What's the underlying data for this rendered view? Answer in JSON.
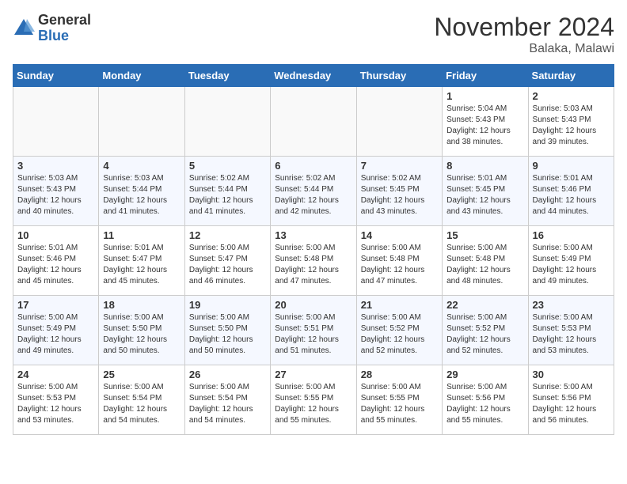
{
  "logo": {
    "general": "General",
    "blue": "Blue"
  },
  "title": "November 2024",
  "location": "Balaka, Malawi",
  "weekdays": [
    "Sunday",
    "Monday",
    "Tuesday",
    "Wednesday",
    "Thursday",
    "Friday",
    "Saturday"
  ],
  "weeks": [
    [
      {
        "day": "",
        "info": ""
      },
      {
        "day": "",
        "info": ""
      },
      {
        "day": "",
        "info": ""
      },
      {
        "day": "",
        "info": ""
      },
      {
        "day": "",
        "info": ""
      },
      {
        "day": "1",
        "info": "Sunrise: 5:04 AM\nSunset: 5:43 PM\nDaylight: 12 hours\nand 38 minutes."
      },
      {
        "day": "2",
        "info": "Sunrise: 5:03 AM\nSunset: 5:43 PM\nDaylight: 12 hours\nand 39 minutes."
      }
    ],
    [
      {
        "day": "3",
        "info": "Sunrise: 5:03 AM\nSunset: 5:43 PM\nDaylight: 12 hours\nand 40 minutes."
      },
      {
        "day": "4",
        "info": "Sunrise: 5:03 AM\nSunset: 5:44 PM\nDaylight: 12 hours\nand 41 minutes."
      },
      {
        "day": "5",
        "info": "Sunrise: 5:02 AM\nSunset: 5:44 PM\nDaylight: 12 hours\nand 41 minutes."
      },
      {
        "day": "6",
        "info": "Sunrise: 5:02 AM\nSunset: 5:44 PM\nDaylight: 12 hours\nand 42 minutes."
      },
      {
        "day": "7",
        "info": "Sunrise: 5:02 AM\nSunset: 5:45 PM\nDaylight: 12 hours\nand 43 minutes."
      },
      {
        "day": "8",
        "info": "Sunrise: 5:01 AM\nSunset: 5:45 PM\nDaylight: 12 hours\nand 43 minutes."
      },
      {
        "day": "9",
        "info": "Sunrise: 5:01 AM\nSunset: 5:46 PM\nDaylight: 12 hours\nand 44 minutes."
      }
    ],
    [
      {
        "day": "10",
        "info": "Sunrise: 5:01 AM\nSunset: 5:46 PM\nDaylight: 12 hours\nand 45 minutes."
      },
      {
        "day": "11",
        "info": "Sunrise: 5:01 AM\nSunset: 5:47 PM\nDaylight: 12 hours\nand 45 minutes."
      },
      {
        "day": "12",
        "info": "Sunrise: 5:00 AM\nSunset: 5:47 PM\nDaylight: 12 hours\nand 46 minutes."
      },
      {
        "day": "13",
        "info": "Sunrise: 5:00 AM\nSunset: 5:48 PM\nDaylight: 12 hours\nand 47 minutes."
      },
      {
        "day": "14",
        "info": "Sunrise: 5:00 AM\nSunset: 5:48 PM\nDaylight: 12 hours\nand 47 minutes."
      },
      {
        "day": "15",
        "info": "Sunrise: 5:00 AM\nSunset: 5:48 PM\nDaylight: 12 hours\nand 48 minutes."
      },
      {
        "day": "16",
        "info": "Sunrise: 5:00 AM\nSunset: 5:49 PM\nDaylight: 12 hours\nand 49 minutes."
      }
    ],
    [
      {
        "day": "17",
        "info": "Sunrise: 5:00 AM\nSunset: 5:49 PM\nDaylight: 12 hours\nand 49 minutes."
      },
      {
        "day": "18",
        "info": "Sunrise: 5:00 AM\nSunset: 5:50 PM\nDaylight: 12 hours\nand 50 minutes."
      },
      {
        "day": "19",
        "info": "Sunrise: 5:00 AM\nSunset: 5:50 PM\nDaylight: 12 hours\nand 50 minutes."
      },
      {
        "day": "20",
        "info": "Sunrise: 5:00 AM\nSunset: 5:51 PM\nDaylight: 12 hours\nand 51 minutes."
      },
      {
        "day": "21",
        "info": "Sunrise: 5:00 AM\nSunset: 5:52 PM\nDaylight: 12 hours\nand 52 minutes."
      },
      {
        "day": "22",
        "info": "Sunrise: 5:00 AM\nSunset: 5:52 PM\nDaylight: 12 hours\nand 52 minutes."
      },
      {
        "day": "23",
        "info": "Sunrise: 5:00 AM\nSunset: 5:53 PM\nDaylight: 12 hours\nand 53 minutes."
      }
    ],
    [
      {
        "day": "24",
        "info": "Sunrise: 5:00 AM\nSunset: 5:53 PM\nDaylight: 12 hours\nand 53 minutes."
      },
      {
        "day": "25",
        "info": "Sunrise: 5:00 AM\nSunset: 5:54 PM\nDaylight: 12 hours\nand 54 minutes."
      },
      {
        "day": "26",
        "info": "Sunrise: 5:00 AM\nSunset: 5:54 PM\nDaylight: 12 hours\nand 54 minutes."
      },
      {
        "day": "27",
        "info": "Sunrise: 5:00 AM\nSunset: 5:55 PM\nDaylight: 12 hours\nand 55 minutes."
      },
      {
        "day": "28",
        "info": "Sunrise: 5:00 AM\nSunset: 5:55 PM\nDaylight: 12 hours\nand 55 minutes."
      },
      {
        "day": "29",
        "info": "Sunrise: 5:00 AM\nSunset: 5:56 PM\nDaylight: 12 hours\nand 55 minutes."
      },
      {
        "day": "30",
        "info": "Sunrise: 5:00 AM\nSunset: 5:56 PM\nDaylight: 12 hours\nand 56 minutes."
      }
    ]
  ]
}
